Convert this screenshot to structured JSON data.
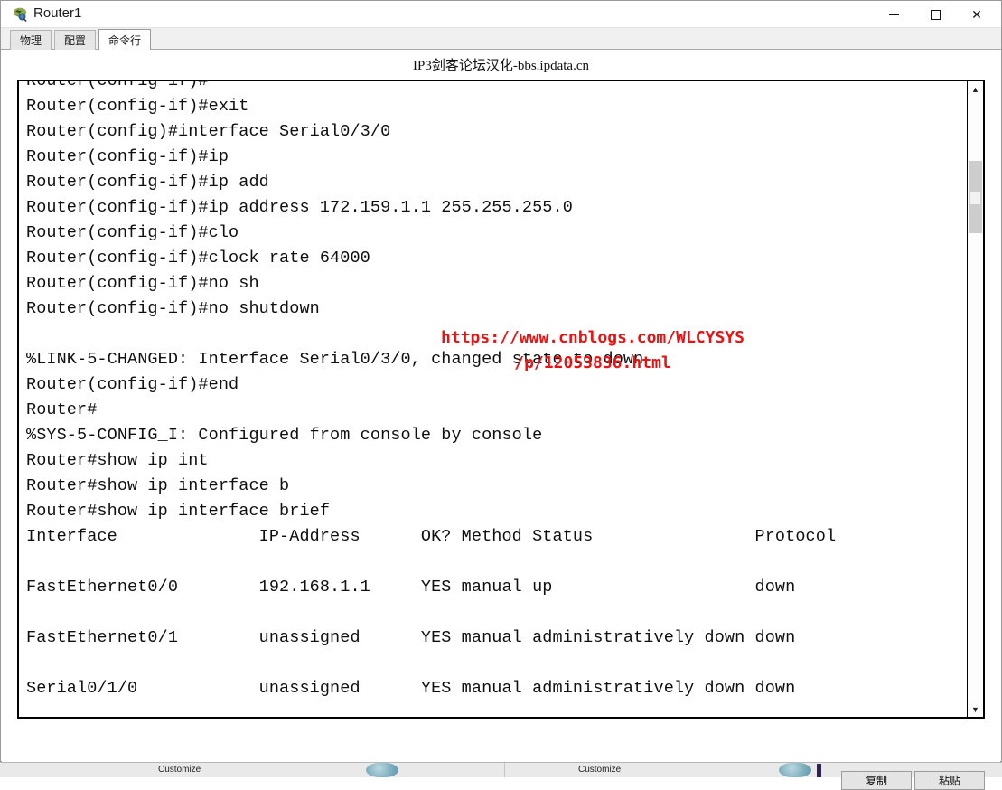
{
  "window": {
    "title": "Router1",
    "icon": "router-icon",
    "controls": {
      "minimize": "minimize-icon",
      "maximize": "maximize-icon",
      "close": "close-icon"
    }
  },
  "tabs": [
    {
      "id": "physical",
      "label": "物理",
      "active": false
    },
    {
      "id": "config",
      "label": "配置",
      "active": false
    },
    {
      "id": "cli",
      "label": "命令行",
      "active": true
    }
  ],
  "cli": {
    "heading": "IP3剑客论坛汉化-bbs.ipdata.cn",
    "terminal_lines": [
      "Router(config-if)#",
      "Router(config-if)#exit",
      "Router(config)#interface Serial0/3/0",
      "Router(config-if)#ip",
      "Router(config-if)#ip add",
      "Router(config-if)#ip address 172.159.1.1 255.255.255.0",
      "Router(config-if)#clo",
      "Router(config-if)#clock rate 64000",
      "Router(config-if)#no sh",
      "Router(config-if)#no shutdown",
      "",
      "%LINK-5-CHANGED: Interface Serial0/3/0, changed state to down",
      "Router(config-if)#end",
      "Router#",
      "%SYS-5-CONFIG_I: Configured from console by console",
      "Router#show ip int",
      "Router#show ip interface b",
      "Router#show ip interface brief",
      "Interface              IP-Address      OK? Method Status                Protocol",
      "",
      "FastEthernet0/0        192.168.1.1     YES manual up                    down",
      "",
      "FastEthernet0/1        unassigned      YES manual administratively down down",
      "",
      "Serial0/1/0            unassigned      YES manual administratively down down"
    ],
    "watermark": "https://www.cnblogs.com/WLCYSYS\n/p/12053836.html",
    "watermark_color": "#ee1111",
    "scrollbar": {
      "up_arrow": "chevron-up-icon",
      "down_arrow": "chevron-down-icon"
    },
    "buttons": {
      "copy": "复制",
      "paste": "粘贴"
    }
  },
  "background": {
    "taskbar_items": [
      {
        "label": "Customize"
      },
      {
        "label": "Customize"
      }
    ]
  }
}
